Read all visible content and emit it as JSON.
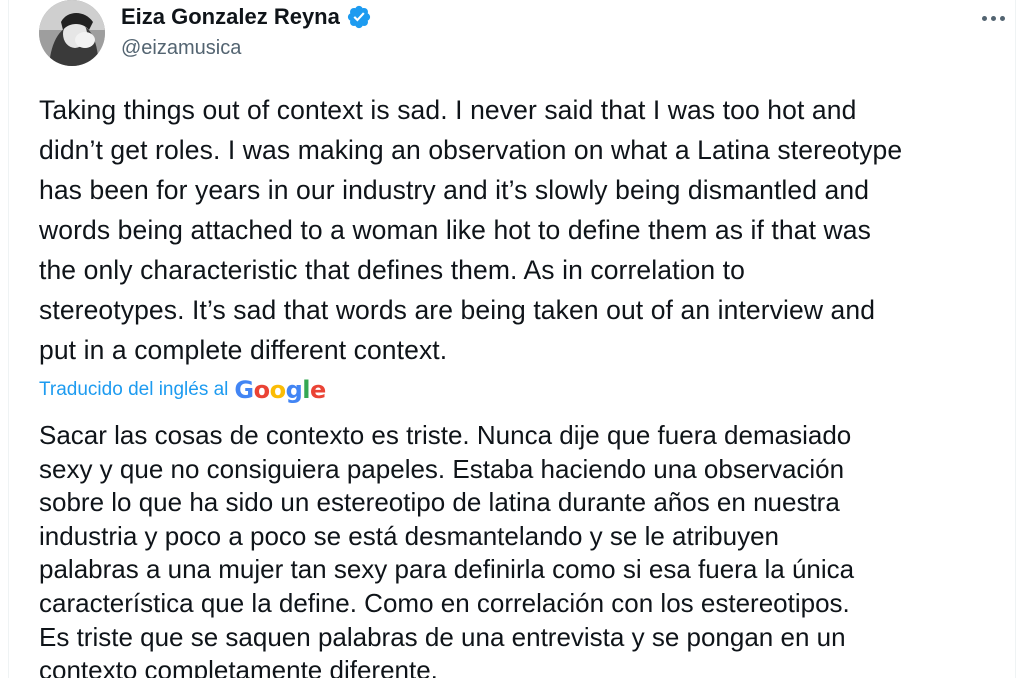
{
  "author": {
    "display_name": "Eiza Gonzalez Reyna",
    "handle": "@eizamusica",
    "verified_icon": "verified-badge-icon",
    "verified_color": "#1d9bf0"
  },
  "menu": {
    "icon": "more-options-icon"
  },
  "tweet": {
    "text": "Taking things out of context is sad. I never said that I was too hot and\ndidn’t get roles. I was making an observation on what a Latina stereotype\nhas been for years in our industry and it’s slowly being dismantled and\nwords being attached to a woman like hot to define them as if that was\nthe only characteristic that defines them. As in correlation to\nstereotypes. It’s sad that words are being taken out of an interview and\nput in a complete different context."
  },
  "translation": {
    "label": "Traducido del inglés al",
    "provider": "Google",
    "provider_colors": [
      "#4285f4",
      "#ea4335",
      "#fbbc05",
      "#4285f4",
      "#34a853",
      "#ea4335"
    ],
    "text": "Sacar las cosas de contexto es triste. Nunca dije que fuera demasiado\nsexy y que no consiguiera papeles. Estaba haciendo una observación\nsobre lo que ha sido un estereotipo de latina durante años en nuestra\nindustria y poco a poco se está desmantelando y se le atribuyen\npalabras a una mujer tan sexy para definirla como si esa fuera la única\ncaracterística que la define. Como en correlación con los estereotipos.\nEs triste que se saquen palabras de una entrevista y se pongan en un\ncontexto completamente diferente."
  },
  "colors": {
    "text_primary": "#0f1419",
    "text_secondary": "#536471",
    "link": "#1d9bf0"
  }
}
